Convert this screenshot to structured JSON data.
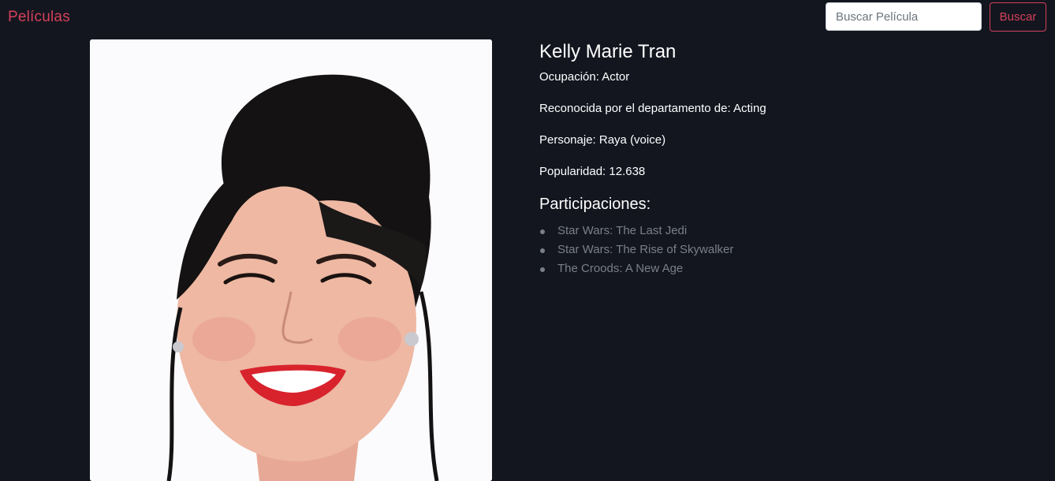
{
  "navbar": {
    "brand": "Películas",
    "search_placeholder": "Buscar Película",
    "search_button": "Buscar"
  },
  "person": {
    "name": "Kelly Marie Tran",
    "occupation": "Ocupación: Actor",
    "department": "Reconocida por el departamento de: Acting",
    "character": "Personaje: Raya (voice)",
    "popularity": "Popularidad: 12.638",
    "photo_icon": "person-photo"
  },
  "credits": {
    "title": "Participaciones:",
    "items": [
      "Star Wars: The Last Jedi",
      "Star Wars: The Rise of Skywalker",
      "The Croods: A New Age"
    ]
  },
  "colors": {
    "background": "#13161f",
    "accent": "#d6405a",
    "muted_link": "#7b7f87"
  }
}
